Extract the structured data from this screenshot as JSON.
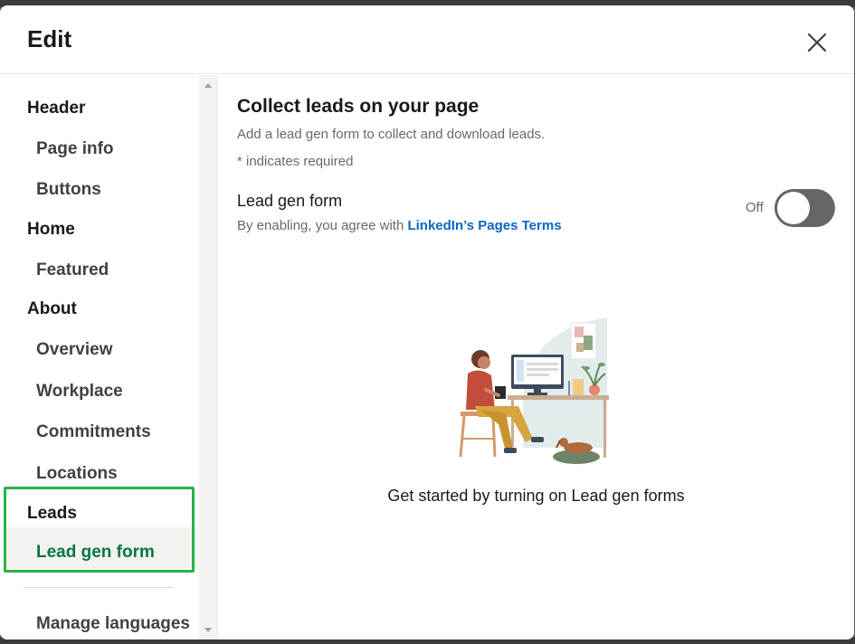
{
  "modal": {
    "title": "Edit",
    "close_icon": "close-icon"
  },
  "sidebar": {
    "sections": [
      {
        "label": "Header",
        "items": [
          {
            "label": "Page info"
          },
          {
            "label": "Buttons"
          }
        ]
      },
      {
        "label": "Home",
        "items": [
          {
            "label": "Featured"
          }
        ]
      },
      {
        "label": "About",
        "items": [
          {
            "label": "Overview"
          },
          {
            "label": "Workplace"
          },
          {
            "label": "Commitments"
          },
          {
            "label": "Locations"
          }
        ]
      },
      {
        "label": "Leads",
        "items": [
          {
            "label": "Lead gen form",
            "active": true
          }
        ]
      }
    ],
    "manage_languages": "Manage languages"
  },
  "main": {
    "title": "Collect leads on your page",
    "subtitle": "Add a lead gen form to collect and download leads.",
    "required_note": "* indicates required",
    "lead_gen": {
      "label": "Lead gen form",
      "desc_prefix": "By enabling, you agree with",
      "terms_link": "LinkedIn’s Pages Terms",
      "toggle_state": "Off",
      "enabled": false
    },
    "empty_state": "Get started by turning on Lead gen forms"
  },
  "colors": {
    "active_green": "#057642",
    "highlight_green": "#2ab24a",
    "link_blue": "#0a66c2",
    "toggle_off": "#666666"
  }
}
